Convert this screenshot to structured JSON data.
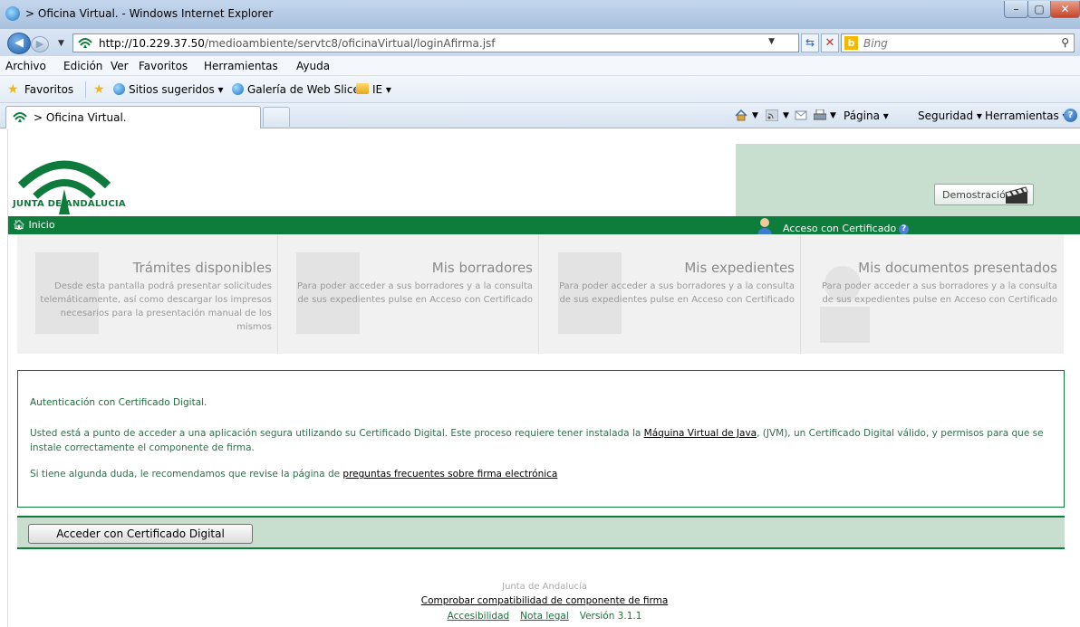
{
  "window": {
    "title": "> Oficina Virtual. - Windows Internet Explorer",
    "minimize": "–",
    "maximize": "▢",
    "close": "✕"
  },
  "address": {
    "url_host": "http://10.229.37.50",
    "url_path": "/medioambiente/servtc8/oficinaVirtual/loginAfirma.jsf",
    "search_placeholder": "Bing"
  },
  "menu": [
    "Archivo",
    "Edición",
    "Ver",
    "Favoritos",
    "Herramientas",
    "Ayuda"
  ],
  "favorites": {
    "label": "Favoritos",
    "items": [
      "Sitios sugeridos ▾",
      "Galería de Web Slice ▾",
      "IE ▾"
    ]
  },
  "tab": {
    "label": "> Oficina Virtual."
  },
  "commands": {
    "page": "Página ▾",
    "security": "Seguridad ▾",
    "tools": "Herramientas ▾"
  },
  "site": {
    "logo_text": "JUNTA DE ANDALUCIA",
    "demo_label": "Demostración",
    "home_label": "Inicio",
    "cert_access_label": "Acceso con Certificado"
  },
  "panels": [
    {
      "title": "Trámites disponibles",
      "text": "Desde esta pantalla podrá presentar solicitudes telemáticamente, así como descargar los impresos necesarios para la presentación manual de los mismos"
    },
    {
      "title": "Mis borradores",
      "text": "Para poder acceder a sus borradores y a la consulta de sus expedientes pulse en Acceso con Certificado"
    },
    {
      "title": "Mis expedientes",
      "text": "Para poder acceder a sus borradores y a la consulta de sus expedientes pulse en Acceso con Certificado"
    },
    {
      "title": "Mis documentos presentados",
      "text": "Para poder acceder a sus borradores y a la consulta de sus expedientes pulse en Acceso con Certificado"
    }
  ],
  "auth": {
    "title": "Autenticación con Certificado Digital.",
    "p1_before": "Usted está a punto de acceder a una aplicación segura utilizando su Certificado Digital. Este proceso requiere tener instalada la ",
    "p1_link": "Máquina Virtual de Java",
    "p1_after": ", (JVM), un Certificado Digital válido, y permisos para que se instale correctamente el componente de firma.",
    "p2_before": "Si tiene algunda duda, le recomendamos que revise la página de ",
    "p2_link": "preguntas frecuentes sobre firma electrónica",
    "button_label": "Acceder con Certificado Digital"
  },
  "footer": {
    "org": "Junta de Andalucía",
    "compat_link": "Comprobar compatibilidad de componente de firma",
    "accessibility": "Accesibilidad",
    "legal": "Nota legal",
    "version": "Versión 3.1.1"
  },
  "colors": {
    "brand_green": "#0e7d3b",
    "light_green": "#c8dfcf"
  }
}
